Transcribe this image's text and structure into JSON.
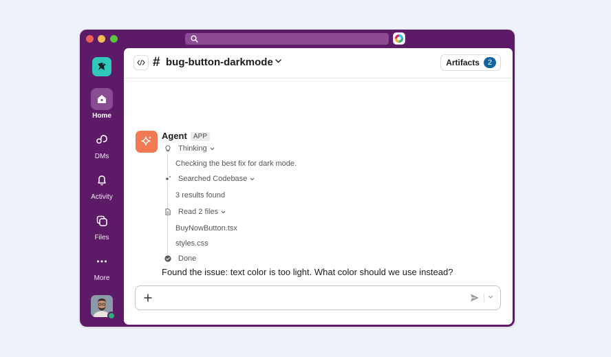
{
  "sidebar": {
    "items": [
      {
        "label": "Home",
        "icon": "home-icon"
      },
      {
        "label": "DMs",
        "icon": "dms-icon"
      },
      {
        "label": "Activity",
        "icon": "bell-icon"
      },
      {
        "label": "Files",
        "icon": "files-icon"
      },
      {
        "label": "More",
        "icon": "more-icon"
      }
    ]
  },
  "header": {
    "hash": "#",
    "channel_name": "bug-button-darkmode",
    "artifacts_label": "Artifacts",
    "artifacts_count": "2"
  },
  "message": {
    "sender": "Agent",
    "badge": "APP",
    "steps": [
      {
        "label": "Thinking",
        "icon": "lightbulb-icon",
        "details": [
          "Checking the best fix for dark mode."
        ]
      },
      {
        "label": "Searched Codebase",
        "icon": "sparkle-search-icon",
        "details": [
          "3 results found"
        ]
      },
      {
        "label": "Read 2 files",
        "icon": "file-icon",
        "details": [
          "BuyNowButton.tsx",
          "styles.css"
        ]
      },
      {
        "label": "Done",
        "icon": "check-circle-icon",
        "details": []
      }
    ],
    "final_text": "Found the issue: text color is too light. What color should we use instead?"
  },
  "composer": {
    "placeholder": ""
  },
  "colors": {
    "window": "#5d1a66",
    "workspace_logo": "#2fc8b9",
    "agent_avatar": "#f17a55",
    "badge": "#1264a3",
    "presence": "#2bac76"
  }
}
